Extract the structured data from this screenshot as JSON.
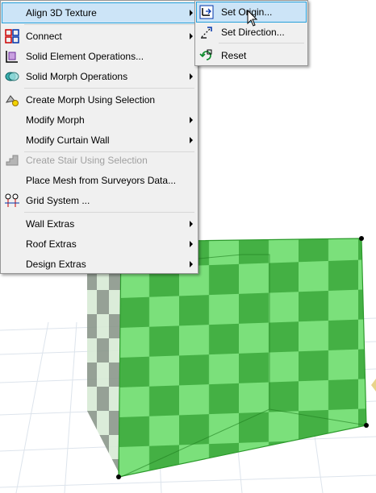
{
  "menu": {
    "items": [
      {
        "label": "Align 3D Texture",
        "icon": "",
        "submenu": true,
        "highlighted": true
      },
      {
        "label": "Connect",
        "icon": "connect-icon",
        "submenu": true
      },
      {
        "label": "Solid Element Operations...",
        "icon": "solid-element-icon",
        "submenu": false
      },
      {
        "label": "Solid Morph Operations",
        "icon": "solid-morph-icon",
        "submenu": true
      },
      {
        "label": "Create Morph Using Selection",
        "icon": "create-morph-icon",
        "submenu": false
      },
      {
        "label": "Modify Morph",
        "icon": "",
        "submenu": true
      },
      {
        "label": "Modify Curtain Wall",
        "icon": "",
        "submenu": true
      },
      {
        "label": "Create Stair Using Selection",
        "icon": "stair-icon",
        "submenu": false,
        "disabled": true
      },
      {
        "label": "Place Mesh from Surveyors Data...",
        "icon": "",
        "submenu": false
      },
      {
        "label": "Grid System ...",
        "icon": "grid-system-icon",
        "submenu": false
      },
      {
        "label": "Wall Extras",
        "icon": "",
        "submenu": true
      },
      {
        "label": "Roof Extras",
        "icon": "",
        "submenu": true
      },
      {
        "label": "Design Extras",
        "icon": "",
        "submenu": true
      }
    ]
  },
  "submenu": {
    "items": [
      {
        "label": "Set Origin...",
        "icon": "set-origin-icon",
        "highlighted": true
      },
      {
        "label": "Set Direction...",
        "icon": "set-direction-icon"
      },
      {
        "label": "Reset",
        "icon": "reset-icon"
      }
    ]
  },
  "scene": {
    "texture_colors": {
      "light": "#7be07b",
      "dark": "#44b044",
      "edge": "#2c9a2c"
    },
    "background": "#ffffff",
    "grid_color": "#dde4ec"
  }
}
